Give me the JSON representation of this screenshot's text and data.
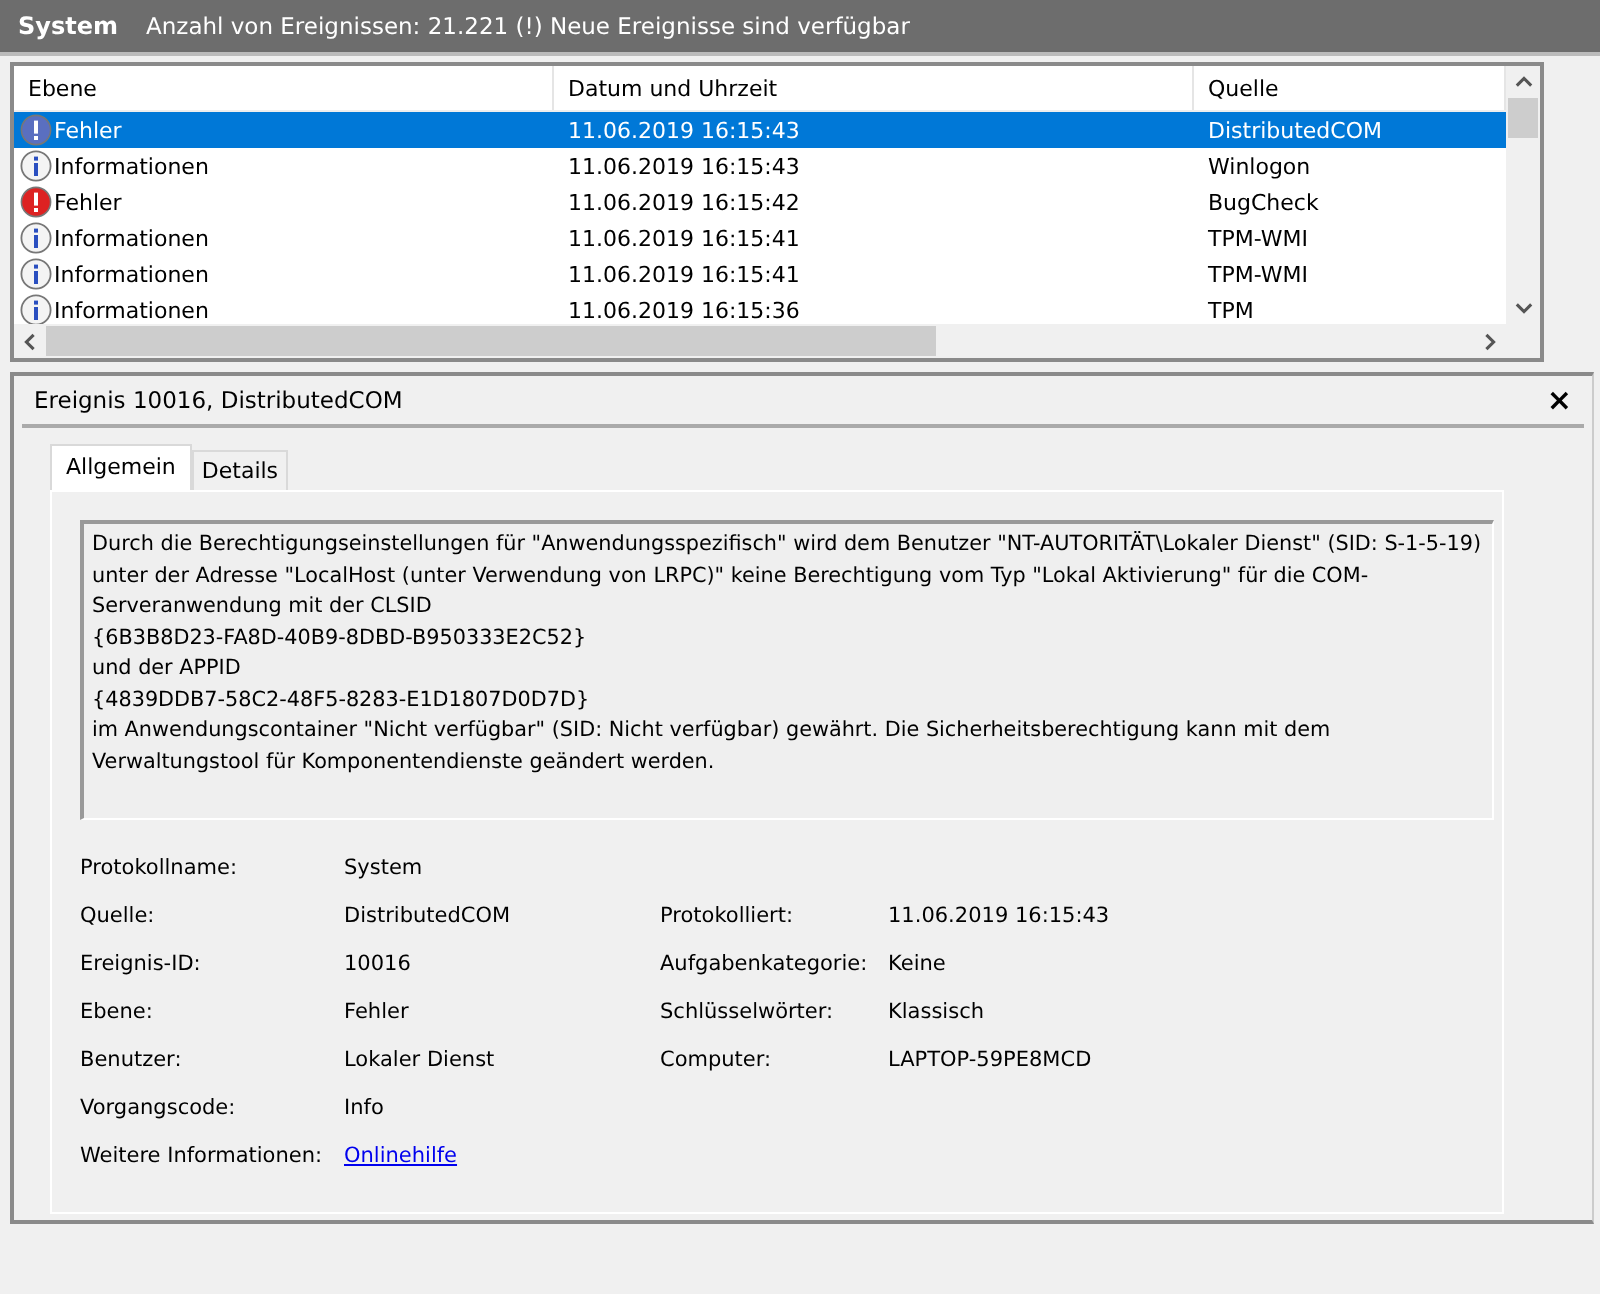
{
  "header": {
    "title": "System",
    "subtitle": "Anzahl von Ereignissen: 21.221 (!) Neue Ereignisse sind verfügbar"
  },
  "table": {
    "columns": [
      "Ebene",
      "Datum und Uhrzeit",
      "Quelle"
    ],
    "rows": [
      {
        "kind": "error",
        "level": "Fehler",
        "date": "11.06.2019 16:15:43",
        "source": "DistributedCOM",
        "selected": true
      },
      {
        "kind": "info",
        "level": "Informationen",
        "date": "11.06.2019 16:15:43",
        "source": "Winlogon",
        "selected": false
      },
      {
        "kind": "error",
        "level": "Fehler",
        "date": "11.06.2019 16:15:42",
        "source": "BugCheck",
        "selected": false
      },
      {
        "kind": "info",
        "level": "Informationen",
        "date": "11.06.2019 16:15:41",
        "source": "TPM-WMI",
        "selected": false
      },
      {
        "kind": "info",
        "level": "Informationen",
        "date": "11.06.2019 16:15:41",
        "source": "TPM-WMI",
        "selected": false
      },
      {
        "kind": "info",
        "level": "Informationen",
        "date": "11.06.2019 16:15:36",
        "source": "TPM",
        "selected": false
      }
    ]
  },
  "detail": {
    "title": "Ereignis 10016, DistributedCOM",
    "close": "×",
    "tabs": [
      {
        "label": "Allgemein",
        "selected": true
      },
      {
        "label": "Details",
        "selected": false
      }
    ],
    "message": "Durch die Berechtigungseinstellungen für \"Anwendungsspezifisch\" wird dem Benutzer \"NT-AUTORITÄT\\Lokaler Dienst\" (SID: S-1-5-19) unter der Adresse \"LocalHost (unter Verwendung von LRPC)\" keine Berechtigung vom Typ \"Lokal Aktivierung\" für die COM-Serveranwendung mit der CLSID\n{6B3B8D23-FA8D-40B9-8DBD-B950333E2C52}\n und der APPID\n{4839DDB7-58C2-48F5-8283-E1D1807D0D7D}\n im Anwendungscontainer \"Nicht verfügbar\" (SID: Nicht verfügbar) gewährt. Die Sicherheitsberechtigung kann mit dem Verwaltungstool für Komponentendienste geändert werden.",
    "fields": [
      [
        {
          "label": "Protokollname:",
          "value": "System"
        }
      ],
      [
        {
          "label": "Quelle:",
          "value": "DistributedCOM"
        },
        {
          "label": "Protokolliert:",
          "value": "11.06.2019 16:15:43"
        }
      ],
      [
        {
          "label": "Ereignis-ID:",
          "value": "10016"
        },
        {
          "label": "Aufgabenkategorie:",
          "value": "Keine"
        }
      ],
      [
        {
          "label": "Ebene:",
          "value": "Fehler"
        },
        {
          "label": "Schlüsselwörter:",
          "value": "Klassisch"
        }
      ],
      [
        {
          "label": "Benutzer:",
          "value": "Lokaler Dienst"
        },
        {
          "label": "Computer:",
          "value": "LAPTOP-59PE8MCD"
        }
      ],
      [
        {
          "label": "Vorgangscode:",
          "value": "Info"
        }
      ],
      [
        {
          "label": "Weitere Informationen:",
          "value": "Onlinehilfe",
          "kind": "link"
        }
      ]
    ]
  }
}
